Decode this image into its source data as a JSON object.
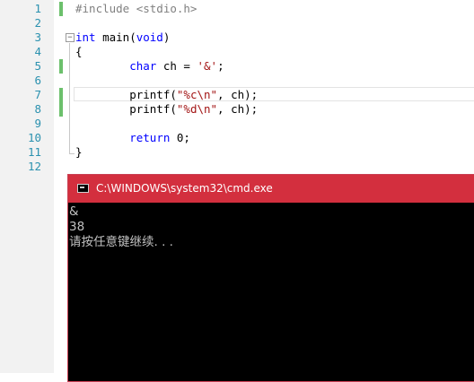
{
  "editor": {
    "lines": [
      {
        "n": "1",
        "parts": [
          {
            "t": "#include <stdio.h>",
            "c": "pp"
          }
        ]
      },
      {
        "n": "2",
        "parts": []
      },
      {
        "n": "3",
        "parts": [
          {
            "t": "int",
            "c": "k"
          },
          {
            "t": " main(",
            "c": ""
          },
          {
            "t": "void",
            "c": "k"
          },
          {
            "t": ")",
            "c": ""
          }
        ]
      },
      {
        "n": "4",
        "parts": [
          {
            "t": "{",
            "c": ""
          }
        ]
      },
      {
        "n": "5",
        "parts": [
          {
            "t": "        ",
            "c": ""
          },
          {
            "t": "char",
            "c": "k"
          },
          {
            "t": " ch = ",
            "c": ""
          },
          {
            "t": "'&'",
            "c": "s"
          },
          {
            "t": ";",
            "c": ""
          }
        ]
      },
      {
        "n": "6",
        "parts": []
      },
      {
        "n": "7",
        "parts": [
          {
            "t": "        printf(",
            "c": ""
          },
          {
            "t": "\"%c\\n\"",
            "c": "s"
          },
          {
            "t": ", ch);",
            "c": ""
          }
        ]
      },
      {
        "n": "8",
        "parts": [
          {
            "t": "        printf(",
            "c": ""
          },
          {
            "t": "\"%d\\n\"",
            "c": "s"
          },
          {
            "t": ", ch);",
            "c": ""
          }
        ]
      },
      {
        "n": "9",
        "parts": []
      },
      {
        "n": "10",
        "parts": [
          {
            "t": "        ",
            "c": ""
          },
          {
            "t": "return",
            "c": "k"
          },
          {
            "t": " 0;",
            "c": ""
          }
        ]
      },
      {
        "n": "11",
        "parts": [
          {
            "t": "}",
            "c": ""
          }
        ]
      },
      {
        "n": "12",
        "parts": []
      }
    ],
    "changed_lines": [
      "1",
      "5",
      "7",
      "8"
    ],
    "fold_marker": "−"
  },
  "cmd_window": {
    "title": "C:\\WINDOWS\\system32\\cmd.exe",
    "output": [
      "&",
      "38",
      "请按任意键继续. . ."
    ]
  }
}
